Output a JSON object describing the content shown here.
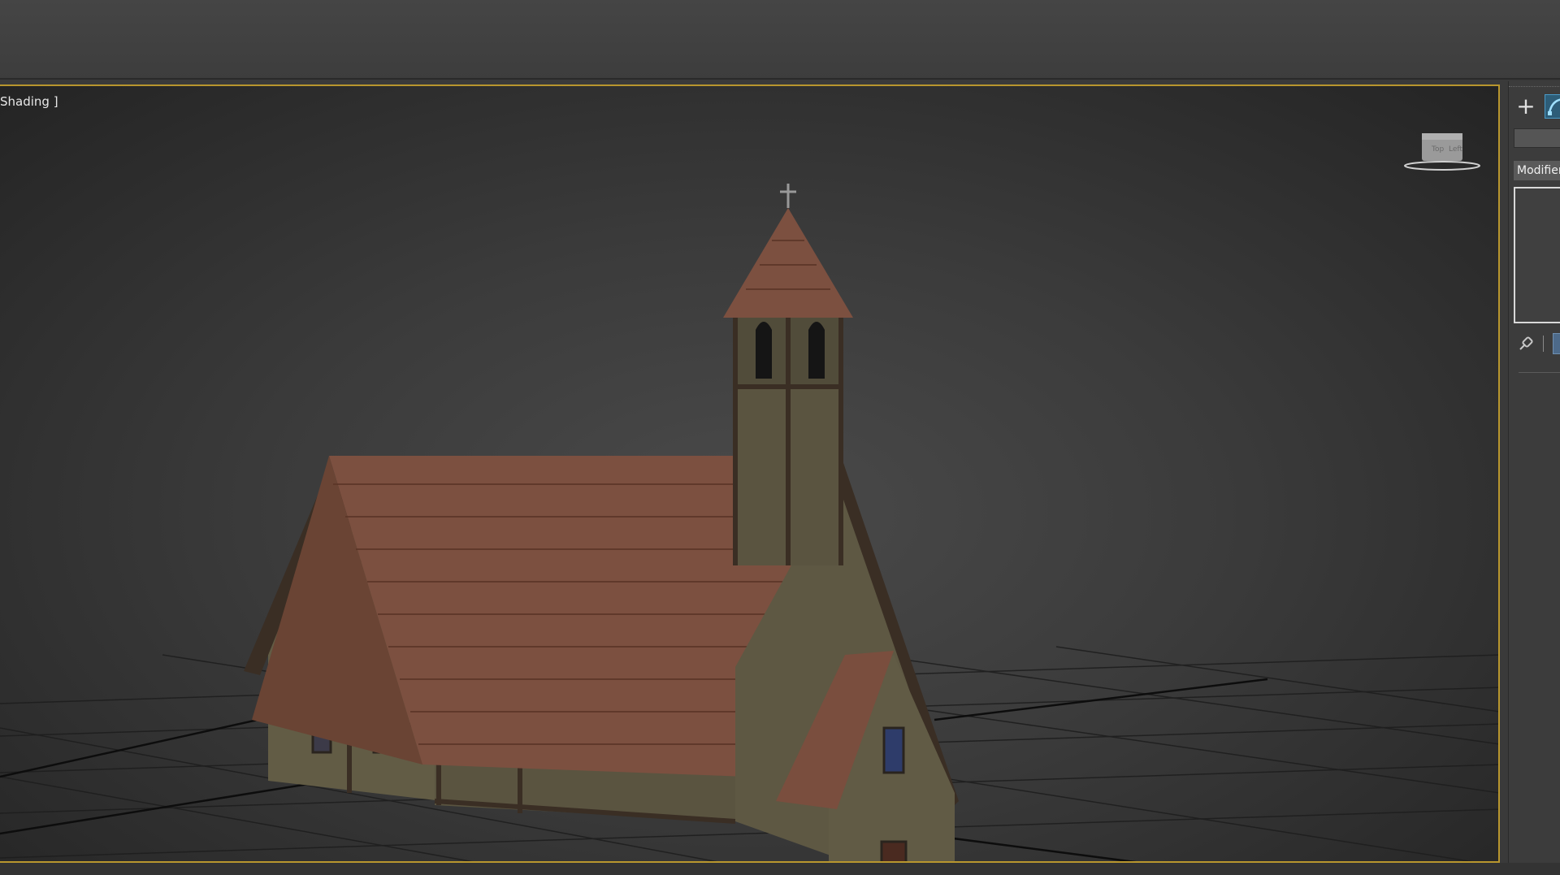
{
  "viewport": {
    "label": "Shading ]",
    "selection_color": "#b8962e",
    "viewcube_labels": [
      "Top",
      "Left"
    ]
  },
  "command_panel": {
    "create_tab_icon": "plus-icon",
    "modify_tab_icon": "modify-icon",
    "modifier_list_label": "Modifier",
    "pin_stack_icon": "pin-icon"
  }
}
